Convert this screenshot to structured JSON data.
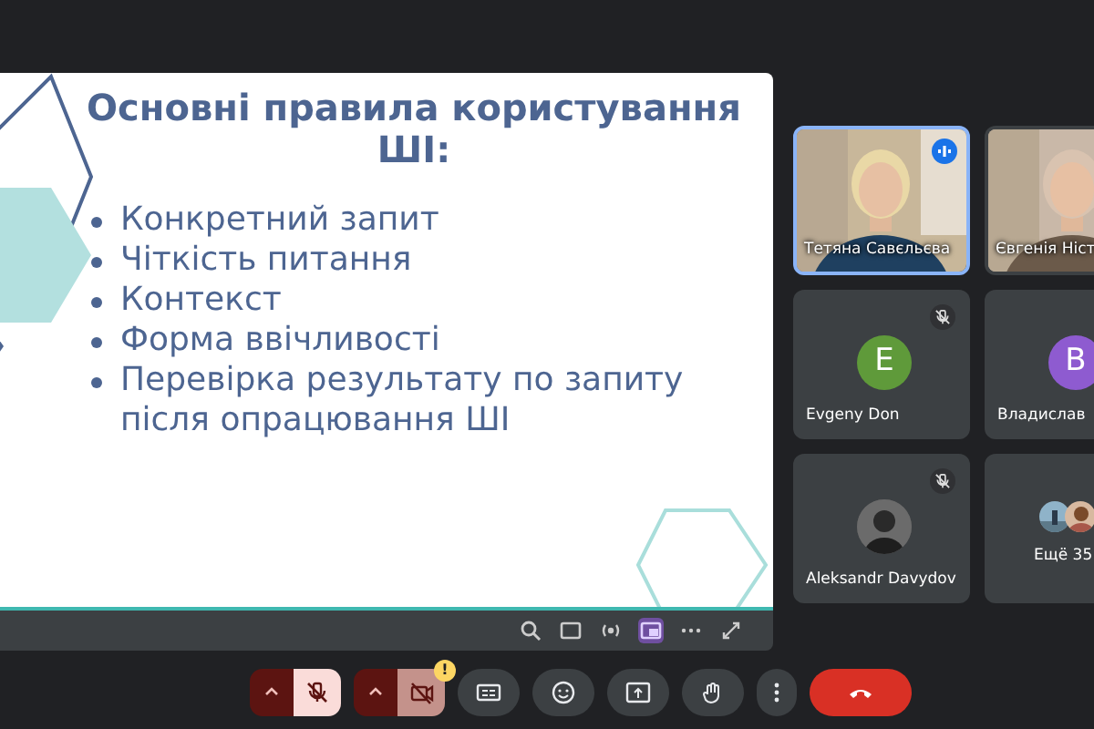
{
  "slide": {
    "title": "Основні правила користування ШІ:",
    "bullets": [
      "Конкретний запит",
      "Чіткість питання",
      "Контекст",
      "Форма ввічливості",
      "Перевірка результату по запиту після опрацювання ШІ"
    ]
  },
  "slide_tools": [
    {
      "kind": "zoom"
    },
    {
      "kind": "captions"
    },
    {
      "kind": "broadcast"
    },
    {
      "kind": "pip",
      "selected": true
    },
    {
      "kind": "more",
      "selected": false
    },
    {
      "kind": "expand"
    }
  ],
  "participants": [
    {
      "kind": "video",
      "name": "Тетяна Савєльєва",
      "speaking": true,
      "muted": false
    },
    {
      "kind": "video",
      "name": "Євгенія Ніст",
      "speaking": false,
      "muted": false
    },
    {
      "kind": "avatar",
      "name": "Evgeny Don",
      "letter": "E",
      "color": "#5f9a3a",
      "speaking": false,
      "muted": true
    },
    {
      "kind": "avatar",
      "name": "Владислав",
      "letter": "В",
      "color": "#8e5bd0",
      "speaking": false,
      "muted": false
    },
    {
      "name": "Aleksandr Davydov",
      "speaking": false,
      "muted": true
    },
    {
      "kind": "more",
      "name": "Ещё 35"
    }
  ],
  "controls": [
    {
      "kind": "mic",
      "off": true
    },
    {
      "kind": "camera",
      "off": true,
      "warning": "!"
    },
    {
      "kind": "captions"
    },
    {
      "kind": "emoji"
    },
    {
      "kind": "present"
    },
    {
      "kind": "hand"
    },
    {
      "kind": "more"
    },
    {
      "kind": "hangup"
    }
  ]
}
